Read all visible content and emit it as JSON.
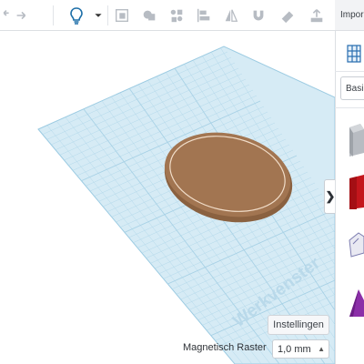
{
  "toolbar": {
    "tools": [
      "undo-icon",
      "redo-icon",
      "bulb-icon",
      "dropdown-icon",
      "workplane-icon",
      "group-icon",
      "align-icon",
      "flip-icon",
      "mirror-icon",
      "magnet-icon",
      "ruler-icon",
      "export-icon"
    ]
  },
  "right_panel": {
    "import_label": "Impor",
    "category_label": "Basi"
  },
  "viewport": {
    "workplane_label": "Werkvenster",
    "settings_label": "Instellingen",
    "snap_grid_label": "Magnetisch Raster",
    "snap_grid_value": "1,0 mm",
    "collapse_glyph": "❯"
  },
  "colors": {
    "workplane_fill": "#d6ebf5",
    "grid_line": "#a9d2e6",
    "disc_fill": "#a27551",
    "disc_rim": "#8a6140"
  }
}
